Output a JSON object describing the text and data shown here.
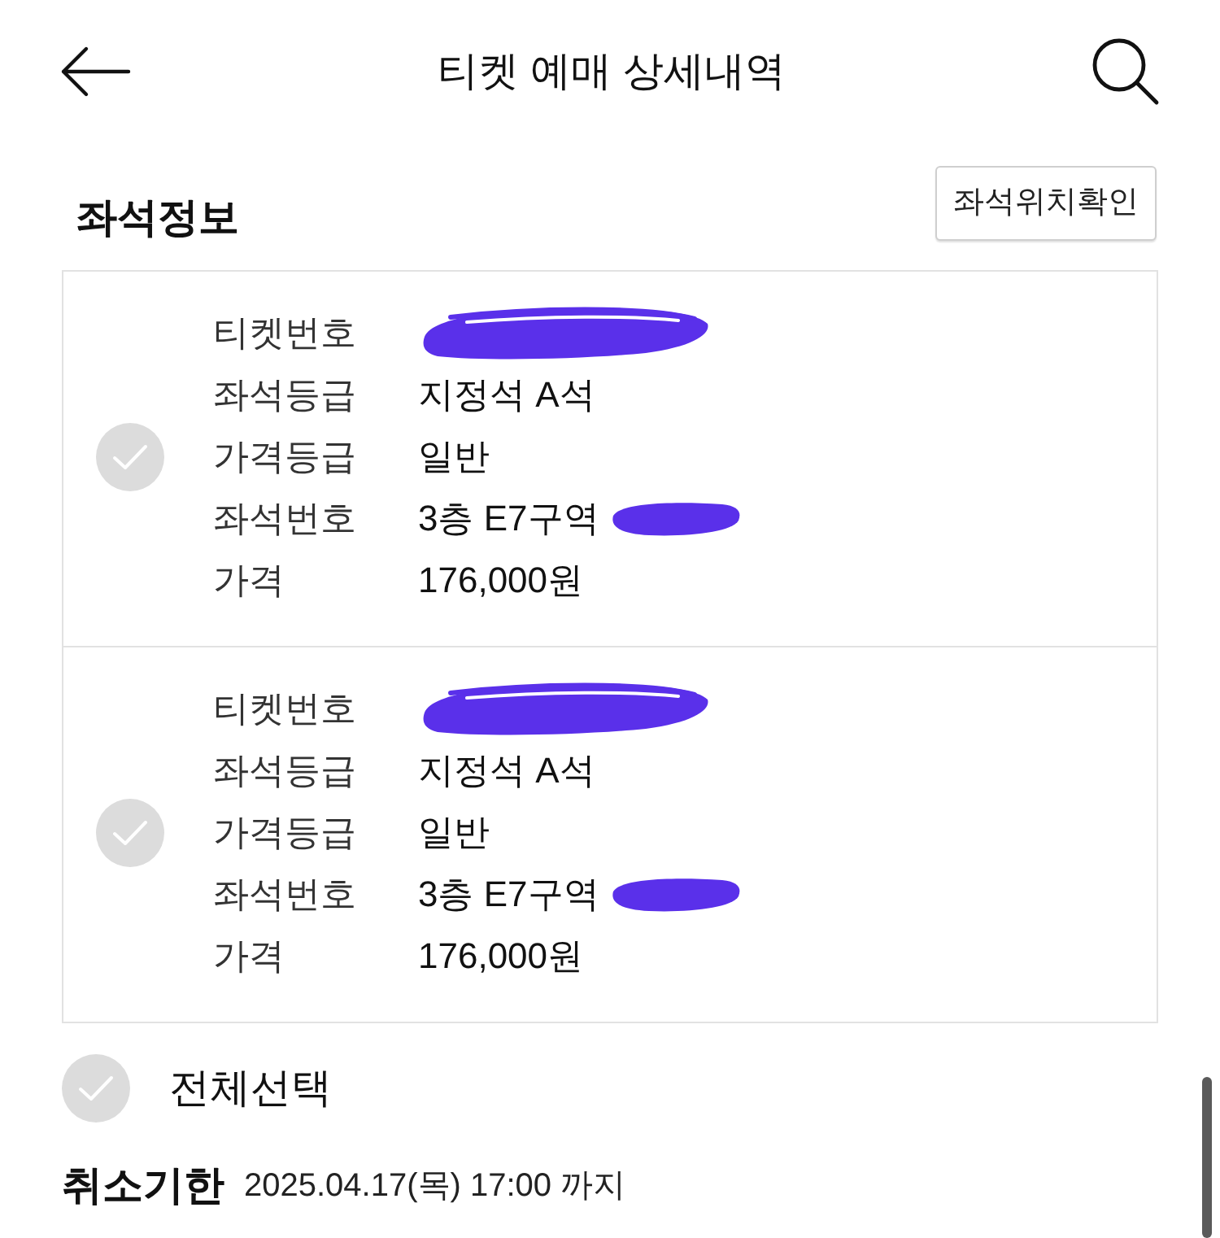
{
  "header": {
    "title": "티켓 예매 상세내역"
  },
  "seat_info": {
    "title": "좌석정보",
    "location_button": "좌석위치확인",
    "tickets": [
      {
        "checked": false,
        "fields": [
          {
            "label": "티켓번호",
            "redacted": true
          },
          {
            "label": "좌석등급",
            "value": "지정석 A석",
            "redacted": false
          },
          {
            "label": "가격등급",
            "value": "일반",
            "redacted": false
          },
          {
            "label": "좌석번호",
            "value": "3층 E7구역",
            "redacted": true
          },
          {
            "label": "가격",
            "value": "176,000원",
            "redacted": false
          }
        ]
      },
      {
        "checked": false,
        "fields": [
          {
            "label": "티켓번호",
            "redacted": true
          },
          {
            "label": "좌석등급",
            "value": "지정석 A석",
            "redacted": false
          },
          {
            "label": "가격등급",
            "value": "일반",
            "redacted": false
          },
          {
            "label": "좌석번호",
            "value": "3층 E7구역",
            "redacted": true
          },
          {
            "label": "가격",
            "value": "176,000원",
            "redacted": false
          }
        ]
      }
    ]
  },
  "select_all": {
    "label": "전체선택",
    "checked": false
  },
  "cancel_deadline": {
    "label": "취소기한",
    "value": "2025.04.17(목) 17:00 까지"
  }
}
